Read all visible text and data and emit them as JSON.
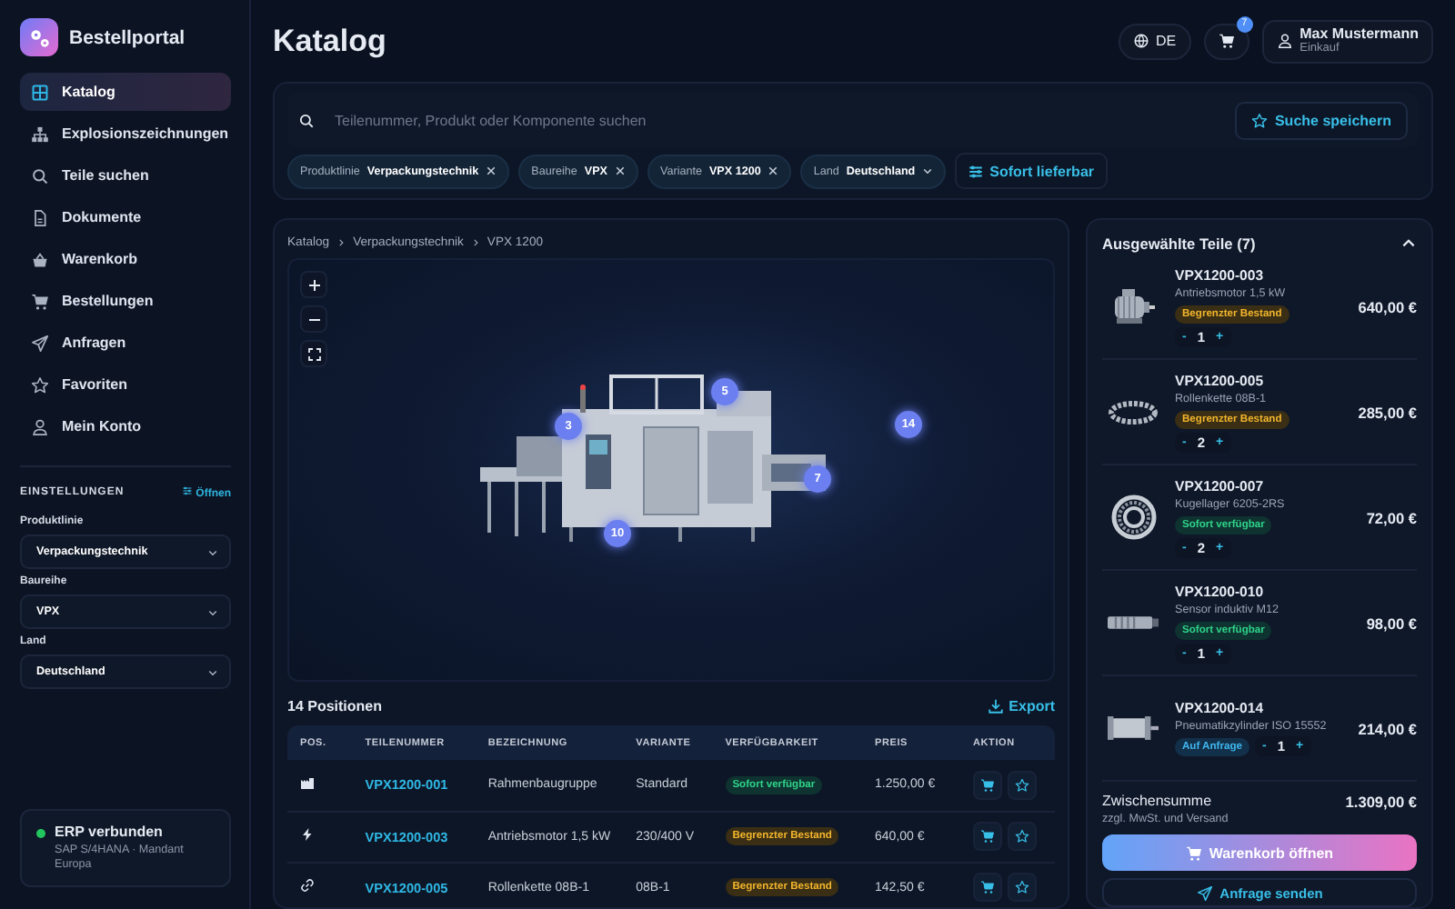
{
  "brand": {
    "name": "Bestellportal"
  },
  "nav": [
    {
      "label": "Katalog",
      "selected": true
    },
    {
      "label": "Explosionszeichnungen",
      "selected": false
    },
    {
      "label": "Teile suchen",
      "selected": false
    },
    {
      "label": "Dokumente",
      "selected": false
    },
    {
      "label": "Warenkorb",
      "selected": false
    },
    {
      "label": "Bestellungen",
      "selected": false
    },
    {
      "label": "Anfragen",
      "selected": false
    },
    {
      "label": "Favoriten",
      "selected": false
    },
    {
      "label": "Mein Konto",
      "selected": false
    }
  ],
  "settings": {
    "title": "EINSTELLUNGEN",
    "action": "Öffnen",
    "fields": [
      {
        "label": "Produktlinie",
        "value": "Verpackungstechnik"
      },
      {
        "label": "Baureihe",
        "value": "VPX"
      },
      {
        "label": "Land",
        "value": "Deutschland"
      }
    ]
  },
  "erp_status": {
    "title": "ERP verbunden",
    "detail": "SAP S/4HANA · Mandant Europa",
    "connected": true
  },
  "header": {
    "title": "Katalog",
    "language": "DE",
    "cart_count": "7",
    "user": {
      "name": "Max Mustermann",
      "role": "Einkauf"
    }
  },
  "search": {
    "placeholder": "Teilenummer, Produkt oder Komponente suchen",
    "save_label": "Suche speichern",
    "filters": [
      {
        "label": "Produktlinie",
        "value": "Verpackungstechnik",
        "kind": "removable"
      },
      {
        "label": "Baureihe",
        "value": "VPX",
        "kind": "removable"
      },
      {
        "label": "Variante",
        "value": "VPX 1200",
        "kind": "removable"
      },
      {
        "label": "Land",
        "value": "Deutschland",
        "kind": "dropdown"
      }
    ],
    "toggle": "Sofort lieferbar"
  },
  "breadcrumb": [
    "Katalog",
    "Verpackungstechnik",
    "VPX 1200"
  ],
  "viewer": {
    "hotspots": [
      "3",
      "5",
      "14",
      "7",
      "10"
    ]
  },
  "table": {
    "count": "14 Positionen",
    "export": "Export",
    "columns": [
      "POS.",
      "TEILENUMMER",
      "BEZEICHNUNG",
      "VARIANTE",
      "VERFÜGBARKEIT",
      "PREIS",
      "AKTION"
    ],
    "rows": [
      {
        "part": "VPX1200-001",
        "name": "Rahmenbaugruppe",
        "variant": "Standard",
        "availability": {
          "label": "Sofort verfügbar",
          "kind": "available"
        },
        "price": "1.250,00 €"
      },
      {
        "part": "VPX1200-003",
        "name": "Antriebsmotor 1,5 kW",
        "variant": "230/400 V",
        "availability": {
          "label": "Begrenzter Bestand",
          "kind": "limited"
        },
        "price": "640,00 €"
      },
      {
        "part": "VPX1200-005",
        "name": "Rollenkette 08B-1",
        "variant": "08B-1",
        "availability": {
          "label": "Begrenzter Bestand",
          "kind": "limited"
        },
        "price": "142,50 €"
      }
    ]
  },
  "selection": {
    "title": "Ausgewählte Teile (7)",
    "expanded": true,
    "items": [
      {
        "part": "VPX1200-003",
        "name": "Antriebsmotor 1,5 kW",
        "availability": {
          "label": "Begrenzter Bestand",
          "kind": "limited"
        },
        "quantity": "1",
        "price": "640,00 €"
      },
      {
        "part": "VPX1200-005",
        "name": "Rollenkette 08B-1",
        "availability": {
          "label": "Begrenzter Bestand",
          "kind": "limited"
        },
        "quantity": "2",
        "price": "285,00 €"
      },
      {
        "part": "VPX1200-007",
        "name": "Kugellager 6205-2RS",
        "availability": {
          "label": "Sofort verfügbar",
          "kind": "available"
        },
        "quantity": "2",
        "price": "72,00 €"
      },
      {
        "part": "VPX1200-010",
        "name": "Sensor induktiv M12",
        "availability": {
          "label": "Sofort verfügbar",
          "kind": "available"
        },
        "quantity": "1",
        "price": "98,00 €"
      },
      {
        "part": "VPX1200-014",
        "name": "Pneumatikzylinder ISO 15552",
        "availability": {
          "label": "Auf Anfrage",
          "kind": "request"
        },
        "quantity": "1",
        "price": "214,00 €"
      }
    ],
    "qty_minus": "-",
    "qty_plus": "+",
    "subtotal_label": "Zwischensumme",
    "subtotal": "1.309,00 €",
    "subtotal_note": "zzgl. MwSt. und Versand",
    "primary": "Warenkorb öffnen",
    "secondary": "Anfrage senden"
  }
}
